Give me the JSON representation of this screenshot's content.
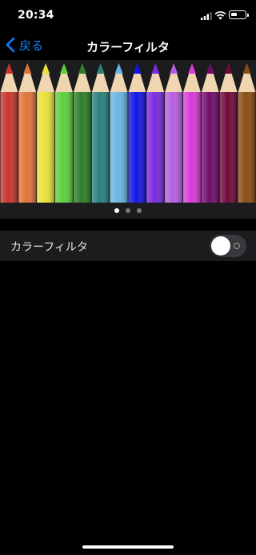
{
  "status_bar": {
    "time": "20:34",
    "icons": [
      "cellular-signal-icon",
      "wifi-icon",
      "battery-icon"
    ],
    "battery_level": 0.45
  },
  "nav": {
    "back_label": "戻る",
    "title": "カラーフィルタ"
  },
  "banner": {
    "image": "colored-pencils-illustration",
    "pencil_colors": [
      "#c6372e",
      "#e0733b",
      "#e8e23b",
      "#5fcf3c",
      "#2f7e2c",
      "#2a7f7b",
      "#6ab4e3",
      "#1515e6",
      "#7a2ae0",
      "#b45ee0",
      "#d93ad8",
      "#6e0e6a",
      "#6e0a38",
      "#8a4e14"
    ]
  },
  "pager": {
    "count": 3,
    "active": 0
  },
  "settings": {
    "color_filter_label": "カラーフィルタ",
    "color_filter_on": false
  },
  "colors": {
    "accent": "#0a84ff",
    "background": "#000000",
    "cell": "#1c1c1e"
  }
}
